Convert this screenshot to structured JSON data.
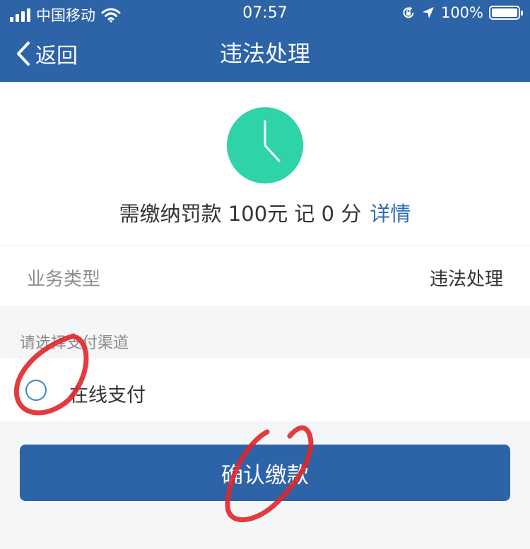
{
  "status_bar": {
    "carrier": "中国移动",
    "time": "07:57",
    "battery": "100%",
    "battery_level": 1.0
  },
  "nav": {
    "back_label": "返回",
    "title": "违法处理"
  },
  "summary": {
    "icon": "clock-icon",
    "fine_text": "需缴纳罚款 100元  记 0 分",
    "detail_link": "详情"
  },
  "business": {
    "label": "业务类型",
    "value": "违法处理"
  },
  "payment": {
    "section_title": "请选择支付渠道",
    "option_label": "在线支付",
    "selected": false
  },
  "confirm_button": "确认缴款",
  "colors": {
    "header_bg": "#2d63a7",
    "accent_green": "#2ed3a8",
    "link_blue": "#2c6db0",
    "annotation_red": "#e0262a"
  }
}
